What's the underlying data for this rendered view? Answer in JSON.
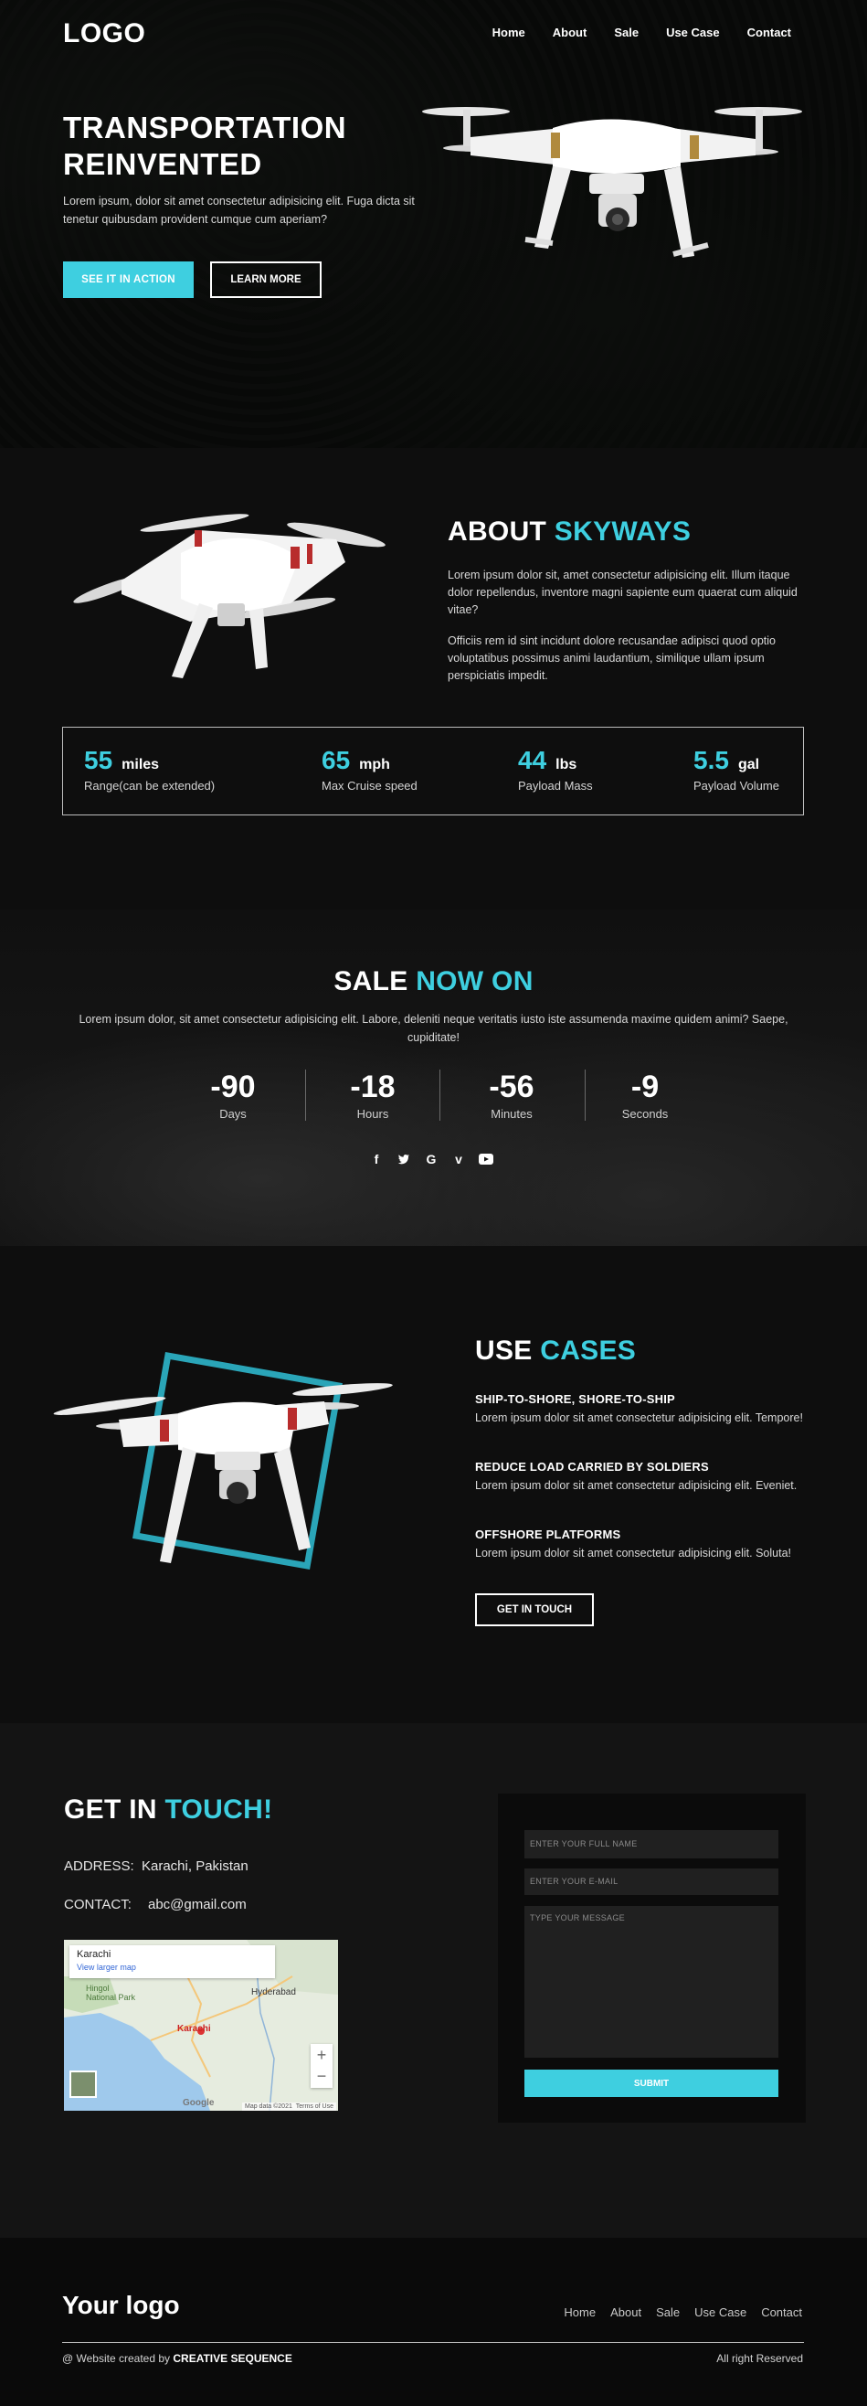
{
  "header": {
    "logo": "LOGO",
    "nav": [
      "Home",
      "About",
      "Sale",
      "Use Case",
      "Contact"
    ]
  },
  "hero": {
    "title_line1": "TRANSPORTATION",
    "title_line2": "REINVENTED",
    "text": "Lorem ipsum, dolor sit amet consectetur adipisicing elit. Fuga dicta sit tenetur quibusdam provident cumque cum aperiam?",
    "primary_button": "SEE IT IN ACTION",
    "secondary_button": "LEARN MORE"
  },
  "about": {
    "title_a": "ABOUT",
    "title_b": "SKYWAYS",
    "para1": "Lorem ipsum dolor sit, amet consectetur adipisicing elit. Illum itaque dolor repellendus, inventore magni sapiente eum quaerat cum aliquid vitae?",
    "para2": "Officiis rem id sint incidunt dolore recusandae adipisci quod optio voluptatibus possimus animi laudantium, similique ullam ipsum perspiciatis impedit.",
    "stats": [
      {
        "num": "55",
        "unit": "miles",
        "label": "Range(can be extended)"
      },
      {
        "num": "65",
        "unit": "mph",
        "label": "Max Cruise speed"
      },
      {
        "num": "44",
        "unit": "lbs",
        "label": "Payload Mass"
      },
      {
        "num": "5.5",
        "unit": "gal",
        "label": "Payload Volume"
      }
    ]
  },
  "sale": {
    "title_a": "SALE",
    "title_b": "NOW ON",
    "text": "Lorem ipsum dolor, sit amet consectetur adipisicing elit. Labore, deleniti neque veritatis iusto iste assumenda maxime quidem animi? Saepe, cupiditate!",
    "counters": [
      {
        "value": "-90",
        "label": "Days"
      },
      {
        "value": "-18",
        "label": "Hours"
      },
      {
        "value": "-56",
        "label": "Minutes"
      },
      {
        "value": "-9",
        "label": "Seconds"
      }
    ],
    "social_icons": [
      "facebook-icon",
      "twitter-icon",
      "google-icon",
      "vimeo-icon",
      "youtube-icon"
    ]
  },
  "usecases": {
    "title_a": "USE",
    "title_b": "CASES",
    "items": [
      {
        "heading": "SHIP-TO-SHORE, SHORE-TO-SHIP",
        "text": "Lorem ipsum dolor sit amet consectetur adipisicing elit. Tempore!"
      },
      {
        "heading": "REDUCE LOAD CARRIED BY SOLDIERS",
        "text": "Lorem ipsum dolor sit amet consectetur adipisicing elit. Eveniet."
      },
      {
        "heading": "OFFSHORE PLATFORMS",
        "text": "Lorem ipsum dolor sit amet consectetur adipisicing elit. Soluta!"
      }
    ],
    "button": "GET IN TOUCH"
  },
  "contact": {
    "title_a": "GET IN",
    "title_b": "TOUCH!",
    "address_label": "ADDRESS:",
    "address_value": "Karachi, Pakistan",
    "contact_label": "CONTACT:",
    "contact_value": "abc@gmail.com",
    "map": {
      "place": "Karachi",
      "link": "View larger map",
      "labels": [
        "Hingol National Park",
        "Hyderabad",
        "Karachi"
      ],
      "footer": "Map data ©2021",
      "terms": "Terms of Use",
      "brand": "Google"
    },
    "form": {
      "name_placeholder": "ENTER YOUR FULL NAME",
      "email_placeholder": "ENTER YOUR E-MAIL",
      "message_placeholder": "TYPE YOUR MESSAGE",
      "submit": "SUBMIT"
    }
  },
  "footer": {
    "logo": "Your logo",
    "nav": [
      "Home",
      "About",
      "Sale",
      "Use Case",
      "Contact"
    ],
    "credit_prefix": "@ Website created by",
    "credit_name": "CREATIVE SEQUENCE",
    "rights": "All right Reserved"
  },
  "colors": {
    "accent": "#3ecfe0",
    "background": "#0e0e0e"
  }
}
